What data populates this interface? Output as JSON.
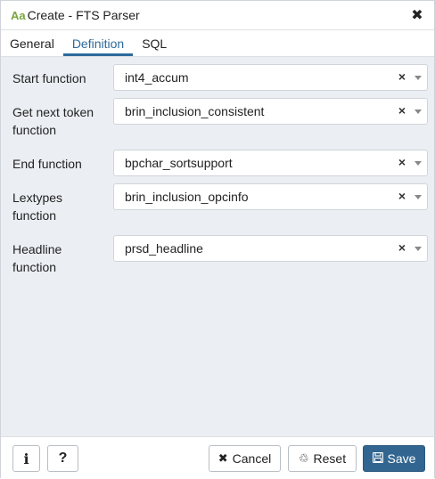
{
  "dialog": {
    "title_icon": "Aa",
    "title": "Create - FTS Parser",
    "close_glyph": "✖"
  },
  "tabs": [
    {
      "label": "General",
      "active": false
    },
    {
      "label": "Definition",
      "active": true
    },
    {
      "label": "SQL",
      "active": false
    }
  ],
  "fields": [
    {
      "label": "Start function",
      "value": "int4_accum"
    },
    {
      "label": "Get next token function",
      "value": "brin_inclusion_consistent"
    },
    {
      "label": "End function",
      "value": "bpchar_sortsupport"
    },
    {
      "label": "Lextypes function",
      "value": "brin_inclusion_opcinfo"
    },
    {
      "label": "Headline function",
      "value": "prsd_headline"
    }
  ],
  "clear_glyph": "×",
  "footer": {
    "info_label": "i",
    "help_label": "?",
    "cancel_label": "Cancel",
    "cancel_icon": "✖",
    "reset_label": "Reset",
    "reset_icon": "♲",
    "save_label": "Save",
    "save_icon": "💾"
  },
  "colors": {
    "accent": "#326690",
    "active_tab": "#2c6a9c",
    "body_bg": "#ebeef3",
    "title_icon": "#7aa53c"
  }
}
